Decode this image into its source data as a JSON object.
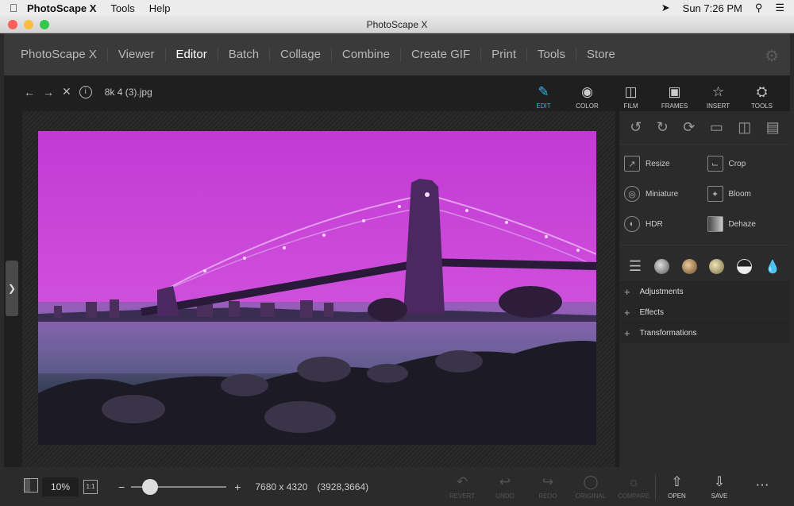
{
  "menubar": {
    "apple": "",
    "app_name": "PhotoScape X",
    "items": [
      "Tools",
      "Help"
    ],
    "clock": "Sun 7:26 PM"
  },
  "window": {
    "title": "PhotoScape X"
  },
  "nav": {
    "tabs": [
      "PhotoScape X",
      "Viewer",
      "Editor",
      "Batch",
      "Collage",
      "Combine",
      "Create GIF",
      "Print",
      "Tools",
      "Store"
    ],
    "active": "Editor"
  },
  "file": {
    "name": "8k 4 (3).jpg"
  },
  "top_tools": [
    "EDIT",
    "COLOR",
    "FILM",
    "FRAMES",
    "INSERT",
    "TOOLS"
  ],
  "effects": [
    {
      "label": "Resize",
      "icon": "resize-icon"
    },
    {
      "label": "Crop",
      "icon": "crop-icon"
    },
    {
      "label": "Miniature",
      "icon": "miniature-icon"
    },
    {
      "label": "Bloom",
      "icon": "bloom-icon"
    },
    {
      "label": "HDR",
      "icon": "hdr-icon"
    },
    {
      "label": "Dehaze",
      "icon": "dehaze-icon"
    }
  ],
  "accordions": [
    "Adjustments",
    "Effects",
    "Transformations"
  ],
  "status": {
    "zoom": "10%",
    "one_to_one": "1:1",
    "dimensions": "7680 x 4320",
    "coords": "(3928,3664)"
  },
  "bottom_buttons": [
    "REVERT",
    "UNDO",
    "REDO",
    "ORIGINAL",
    "COMPARE",
    "OPEN",
    "SAVE"
  ],
  "colors": {
    "accent": "#2fb7ea",
    "photo_sky": "#c83ad8"
  }
}
